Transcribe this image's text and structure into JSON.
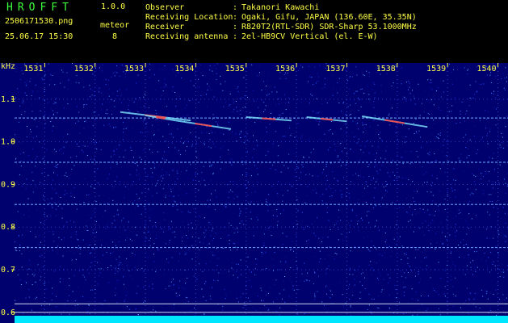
{
  "header": {
    "brand": "HROFFT",
    "version": "1.0.0",
    "filename": "2506171530.png",
    "datetime": "25.06.17 15:30",
    "mode_label": "meteor",
    "count": "8",
    "info": [
      {
        "label": "Observer",
        "value": "Takanori Kawachi"
      },
      {
        "label": "Receiving Location",
        "value": "Ogaki, Gifu, JAPAN (136.60E, 35.35N)"
      },
      {
        "label": "Receiver",
        "value": "R820T2(RTL-SDR) SDR-Sharp 53.1000MHz"
      },
      {
        "label": "Receiving antenna",
        "value": "2el-HB9CV Vertical (el. E-W)"
      }
    ],
    "separator": ":"
  },
  "colors": {
    "background": "#00006e",
    "text_green": "#3cff3c",
    "text_yellow": "#ffff46",
    "noise_floor": "#00e6ff"
  },
  "chart_data": {
    "type": "heatmap",
    "ylabel": "kHz",
    "x_ticks": [
      "1531",
      "1532",
      "1533",
      "1534",
      "1535",
      "1536",
      "1537",
      "1538",
      "1539",
      "1540"
    ],
    "x_range": [
      1530.4,
      1540.2
    ],
    "y_ticks": [
      "1.1",
      "1.0",
      "0.9",
      "0.8",
      "0.7",
      "0.6"
    ],
    "y_range": [
      0.575,
      1.185
    ],
    "carriers_khz": [
      1.056,
      0.952,
      0.853,
      0.752,
      0.62,
      0.6
    ],
    "meteor_echoes": [
      {
        "x_start": 1532.5,
        "x_end": 1533.9,
        "f_start": 1.07,
        "f_end": 1.05
      },
      {
        "x_start": 1533.0,
        "x_end": 1533.6,
        "f_start": 1.062,
        "f_end": 1.05
      },
      {
        "x_start": 1533.6,
        "x_end": 1534.7,
        "f_start": 1.05,
        "f_end": 1.03
      },
      {
        "x_start": 1535.0,
        "x_end": 1535.9,
        "f_start": 1.058,
        "f_end": 1.05
      },
      {
        "x_start": 1536.2,
        "x_end": 1537.0,
        "f_start": 1.058,
        "f_end": 1.048
      },
      {
        "x_start": 1537.3,
        "x_end": 1538.6,
        "f_start": 1.06,
        "f_end": 1.035
      }
    ]
  }
}
